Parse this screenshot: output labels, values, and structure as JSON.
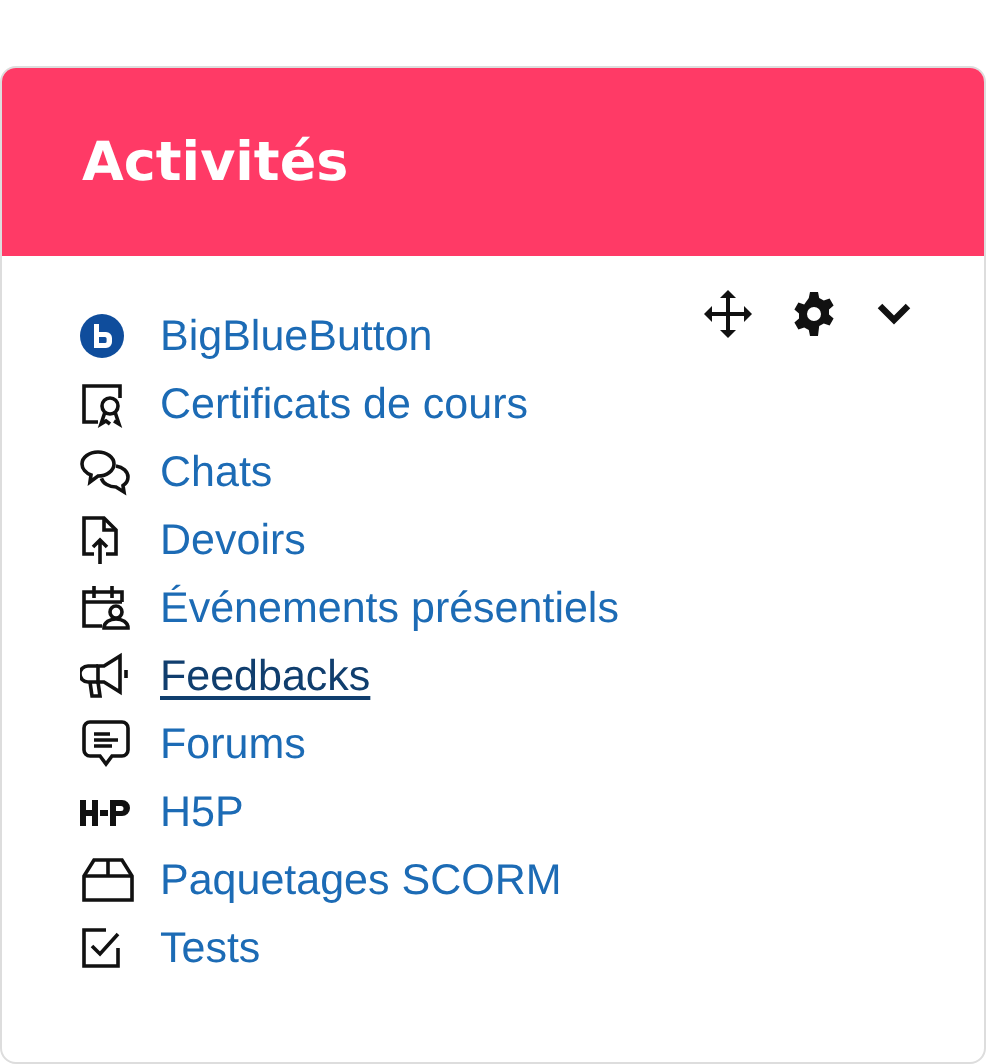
{
  "block": {
    "title": "Activités",
    "items": [
      {
        "kind": "bigbluebutton",
        "label": "BigBlueButton",
        "hovered": false
      },
      {
        "kind": "certificate",
        "label": "Certificats de cours",
        "hovered": false
      },
      {
        "kind": "chat",
        "label": "Chats",
        "hovered": false
      },
      {
        "kind": "assignment",
        "label": "Devoirs",
        "hovered": false
      },
      {
        "kind": "event",
        "label": "Événements présentiels",
        "hovered": false
      },
      {
        "kind": "feedback",
        "label": "Feedbacks",
        "hovered": true
      },
      {
        "kind": "forum",
        "label": "Forums",
        "hovered": false
      },
      {
        "kind": "h5p",
        "label": "H5P",
        "hovered": false
      },
      {
        "kind": "scorm",
        "label": "Paquetages SCORM",
        "hovered": false
      },
      {
        "kind": "quiz",
        "label": "Tests",
        "hovered": false
      }
    ]
  }
}
